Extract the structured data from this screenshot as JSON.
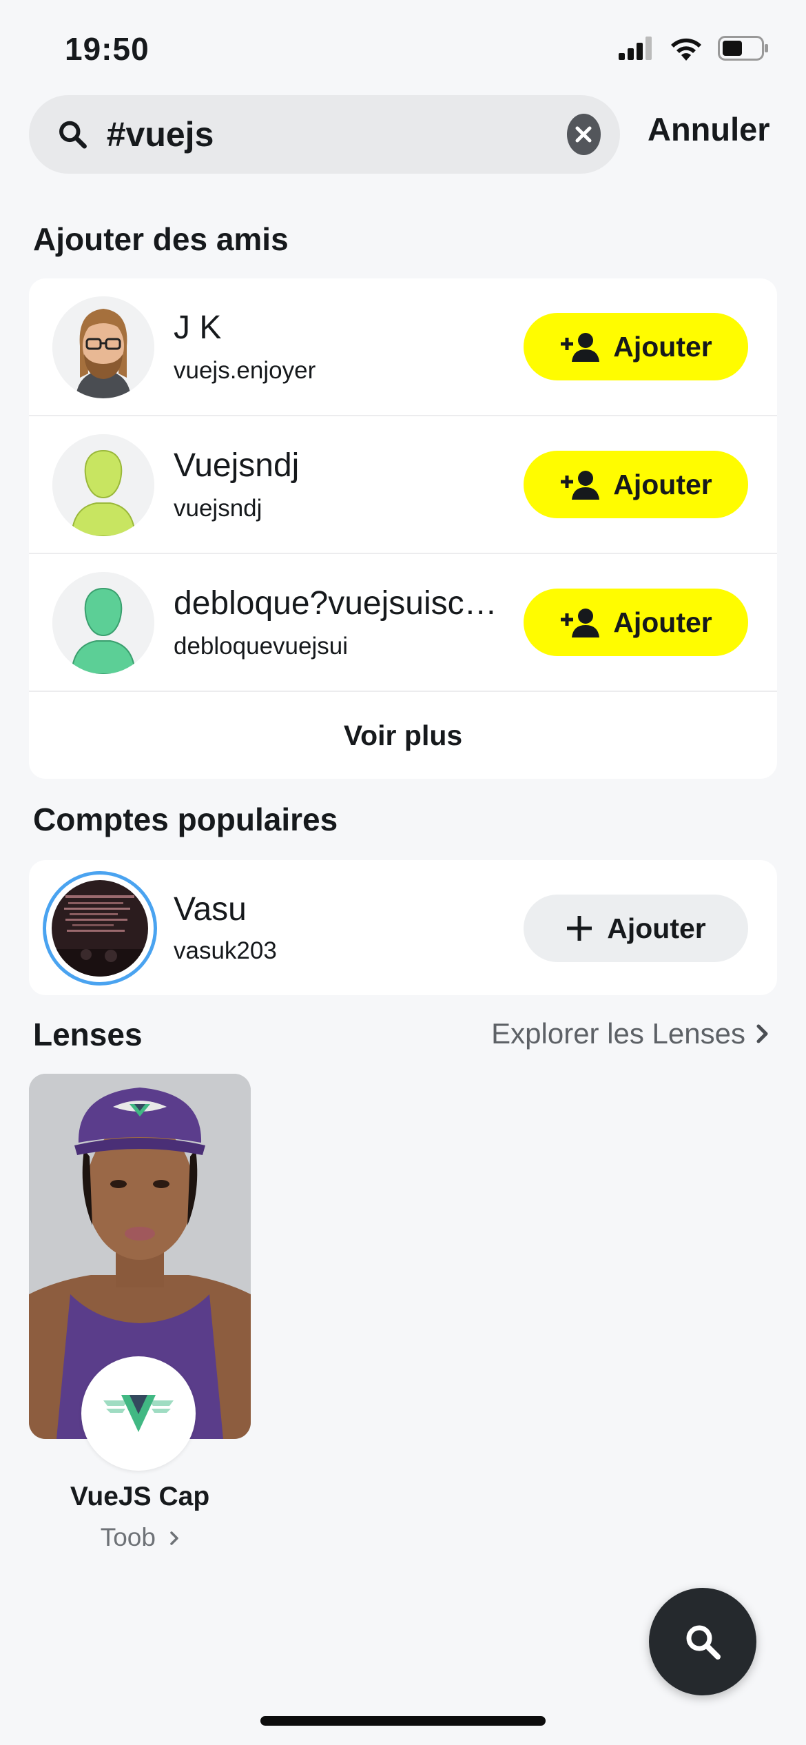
{
  "status_bar": {
    "time": "19:50"
  },
  "search": {
    "query": "#vuejs",
    "cancel_label": "Annuler"
  },
  "add_friends": {
    "title": "Ajouter des amis",
    "items": [
      {
        "name": "J K",
        "username": "vuejs.enjoyer",
        "button": "Ajouter"
      },
      {
        "name": "Vuejsndj",
        "username": "vuejsndj",
        "button": "Ajouter"
      },
      {
        "name": "debloque?vuejsuisc…",
        "username": "debloquevuejsui",
        "button": "Ajouter"
      }
    ],
    "more_label": "Voir plus"
  },
  "popular_accounts": {
    "title": "Comptes populaires",
    "items": [
      {
        "name": "Vasu",
        "username": "vasuk203",
        "button": "Ajouter"
      }
    ]
  },
  "lenses": {
    "title": "Lenses",
    "explore_label": "Explorer les Lenses",
    "items": [
      {
        "name": "VueJS Cap",
        "creator": "Toob"
      }
    ]
  },
  "colors": {
    "accent_yellow": "#fffc00",
    "avatar_green_light": "#c8e561",
    "avatar_green_dark": "#5ccf96",
    "vue_green": "#41b883",
    "vue_dark": "#34495e"
  }
}
